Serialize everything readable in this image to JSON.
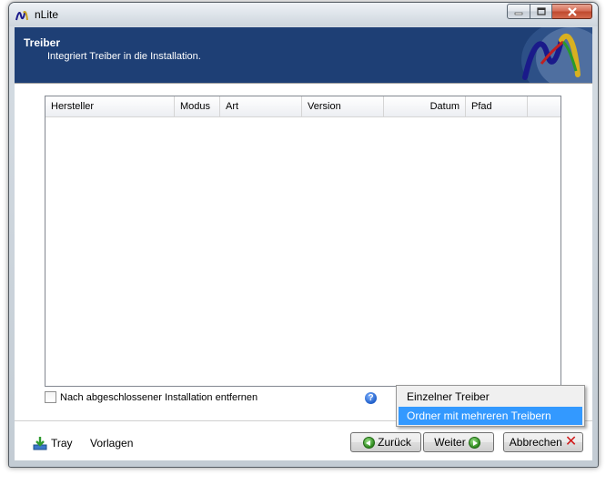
{
  "window": {
    "title": "nLite",
    "controls": {
      "minimize_icon": "minimize-icon",
      "maximize_icon": "maximize-icon",
      "close_icon": "close-icon"
    }
  },
  "header": {
    "title": "Treiber",
    "subtitle": "Integriert Treiber in die Installation.",
    "background": "#1e3f75"
  },
  "table": {
    "columns": [
      "Hersteller",
      "Modus",
      "Art",
      "Version",
      "Datum",
      "Pfad"
    ],
    "rows": []
  },
  "options": {
    "remove_after_install_label": "Nach abgeschlossener Installation entfernen",
    "remove_after_install_checked": false
  },
  "footer": {
    "tray_label": "Tray",
    "templates_label": "Vorlagen",
    "back_label": "Zurück",
    "next_label": "Weiter",
    "cancel_label": "Abbrechen"
  },
  "context_menu": {
    "items": [
      {
        "label": "Einzelner Treiber",
        "highlighted": false
      },
      {
        "label": "Ordner mit mehreren Treibern",
        "highlighted": true
      }
    ],
    "highlight_color": "#3399ff"
  }
}
